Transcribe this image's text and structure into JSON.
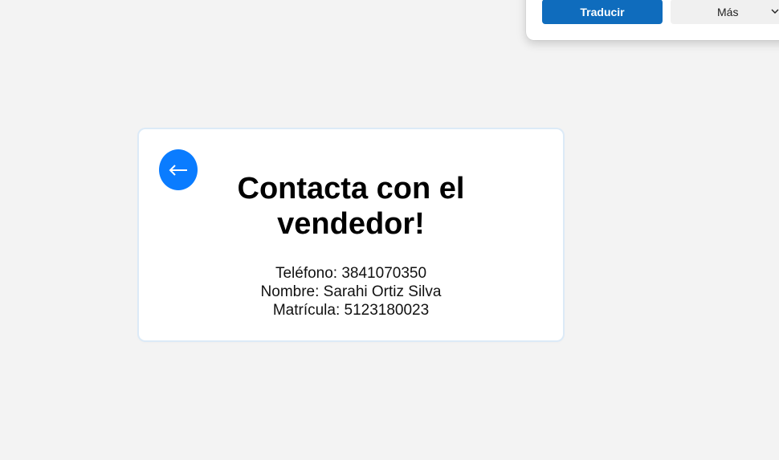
{
  "translate_popup": {
    "translate_label": "Traducir",
    "more_label": "Más"
  },
  "card": {
    "back_icon": "arrow-left-icon",
    "title": "Contacta con el vendedor!",
    "phone": "Teléfono: 3841070350",
    "name": "Nombre: Sarahi Ortiz Silva",
    "matricula": "Matrícula: 5123180023"
  },
  "colors": {
    "accent": "#0a7cff",
    "translate_button": "#0f6cbd",
    "background": "#f3f3f3"
  }
}
